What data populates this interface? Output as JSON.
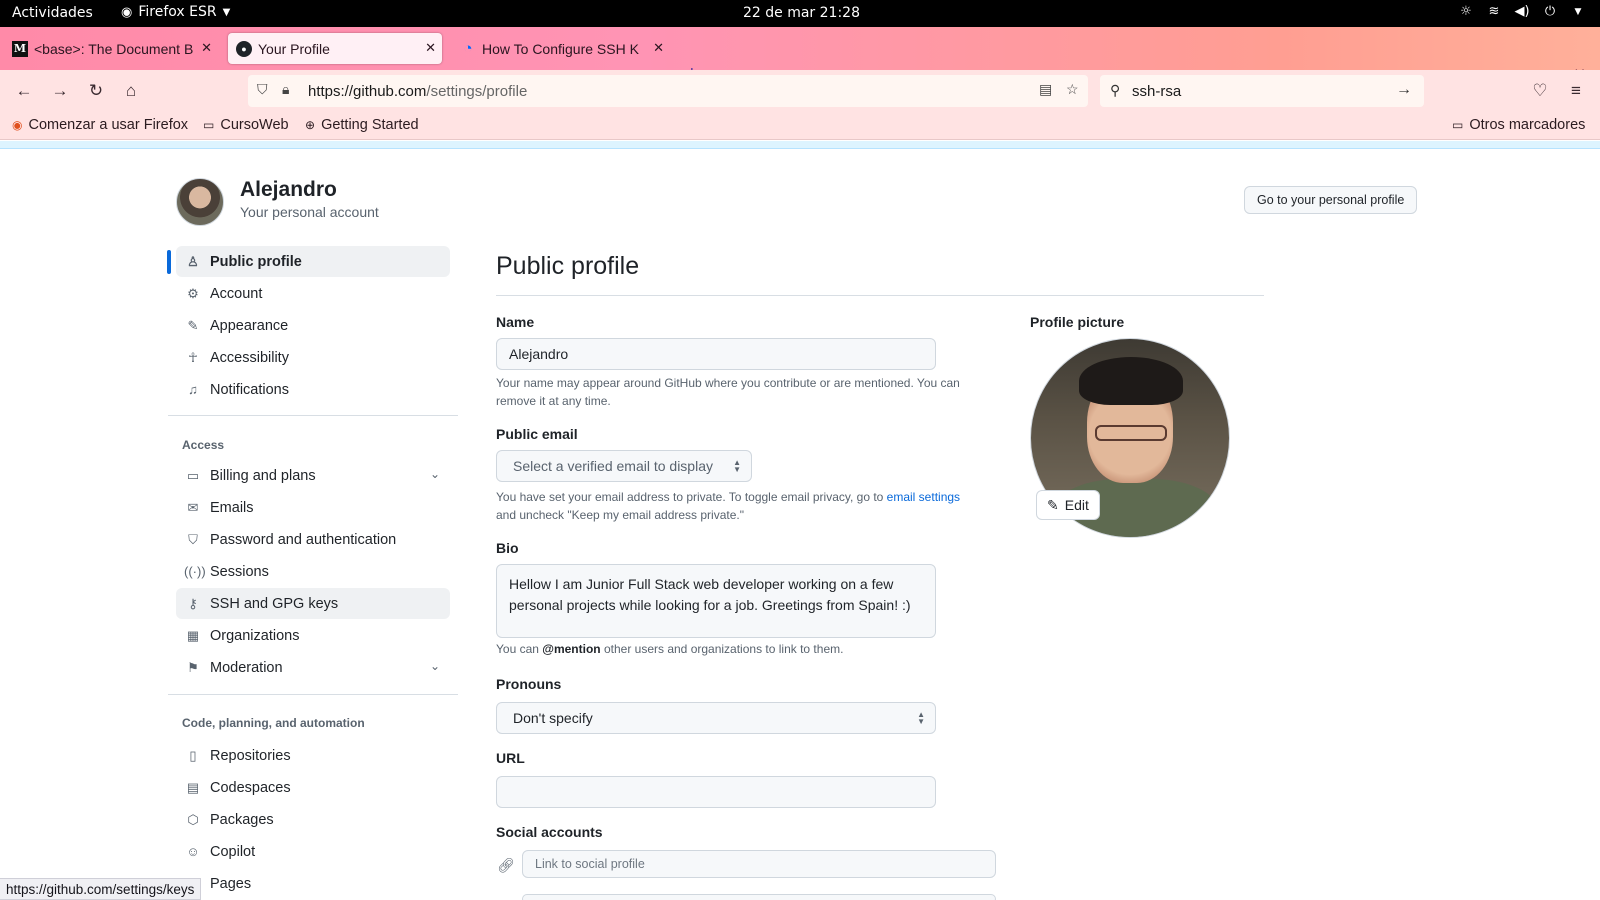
{
  "system": {
    "activities": "Actividades",
    "app": "Firefox ESR",
    "clock": "22 de mar  21:28"
  },
  "tabs": [
    {
      "title": "<base>: The Document B",
      "favicon": "M"
    },
    {
      "title": "Your Profile",
      "favicon": "github-icon"
    },
    {
      "title": "How To Configure SSH K",
      "favicon": "do-icon"
    }
  ],
  "navbar": {
    "url_domain": "https://github.com",
    "url_path": "/settings/profile",
    "search_value": "ssh-rsa"
  },
  "bookmarks": [
    {
      "label": "Comenzar a usar Firefox",
      "icon": "firefox-icon"
    },
    {
      "label": "CursoWeb",
      "icon": "folder-icon"
    },
    {
      "label": "Getting Started",
      "icon": "globe-icon"
    }
  ],
  "bookmarks_other": "Otros marcadores",
  "account": {
    "name": "Alejandro",
    "subtitle": "Your personal account",
    "go_profile": "Go to your personal profile"
  },
  "sidebar": {
    "items": [
      {
        "label": "Public profile",
        "icon": "person-icon"
      },
      {
        "label": "Account",
        "icon": "gear-icon"
      },
      {
        "label": "Appearance",
        "icon": "paintbrush-icon"
      },
      {
        "label": "Accessibility",
        "icon": "accessibility-icon"
      },
      {
        "label": "Notifications",
        "icon": "bell-icon"
      }
    ],
    "access_heading": "Access",
    "access_items": [
      {
        "label": "Billing and plans",
        "icon": "credit-card-icon"
      },
      {
        "label": "Emails",
        "icon": "mail-icon"
      },
      {
        "label": "Password and authentication",
        "icon": "shield-icon"
      },
      {
        "label": "Sessions",
        "icon": "broadcast-icon"
      },
      {
        "label": "SSH and GPG keys",
        "icon": "key-icon"
      },
      {
        "label": "Organizations",
        "icon": "organization-icon"
      },
      {
        "label": "Moderation",
        "icon": "report-icon"
      }
    ],
    "code_heading": "Code, planning, and automation",
    "code_items": [
      {
        "label": "Repositories",
        "icon": "repo-icon"
      },
      {
        "label": "Codespaces",
        "icon": "codespaces-icon"
      },
      {
        "label": "Packages",
        "icon": "package-icon"
      },
      {
        "label": "Copilot",
        "icon": "copilot-icon"
      },
      {
        "label": "Pages",
        "icon": "browser-icon"
      }
    ]
  },
  "form": {
    "title": "Public profile",
    "name_label": "Name",
    "name_value": "Alejandro",
    "name_note": "Your name may appear around GitHub where you contribute or are mentioned. You can remove it at any time.",
    "email_label": "Public email",
    "email_select": "Select a verified email to display",
    "email_note_pre": "You have set your email address to private. To toggle email privacy, go to ",
    "email_note_link": "email settings",
    "email_note_post": "and uncheck \"Keep my email address private.\"",
    "bio_label": "Bio",
    "bio_value": "Hellow I am Junior Full Stack web developer working on a few personal projects while looking for a job. Greetings from Spain! :)",
    "bio_note_pre": "You can ",
    "bio_note_mention": "@mention",
    "bio_note_post": " other users and organizations to link to them.",
    "pronouns_label": "Pronouns",
    "pronouns_value": "Don't specify",
    "url_label": "URL",
    "url_value": "",
    "social_label": "Social accounts",
    "social_placeholder": "Link to social profile",
    "picture_label": "Profile picture",
    "edit_label": "Edit"
  },
  "status_url": "https://github.com/settings/keys"
}
